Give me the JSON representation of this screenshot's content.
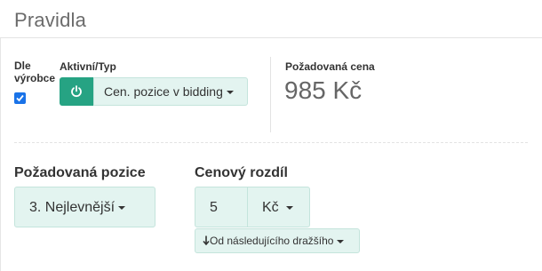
{
  "card": {
    "title": "Pravidla"
  },
  "rules": {
    "by_manufacturer_label": "Dle výrobce",
    "by_manufacturer_checked": true,
    "active_type_label": "Aktivní/Typ",
    "type_dropdown_value": "Cen. pozice v bidding",
    "required_price_label": "Požadovaná cena",
    "required_price_value": "985 Kč"
  },
  "position": {
    "label": "Požadovaná pozice",
    "value": "3. Nejlevnější"
  },
  "price_diff": {
    "label": "Cenový rozdíl",
    "value": "5",
    "currency": "Kč",
    "relation": "Od následujícího dražšího",
    "relation_icon": "arrow-down-icon"
  },
  "colors": {
    "accent_green": "#26a383",
    "control_bg": "#e3f4f0",
    "checkbox_blue": "#1a73e8"
  }
}
